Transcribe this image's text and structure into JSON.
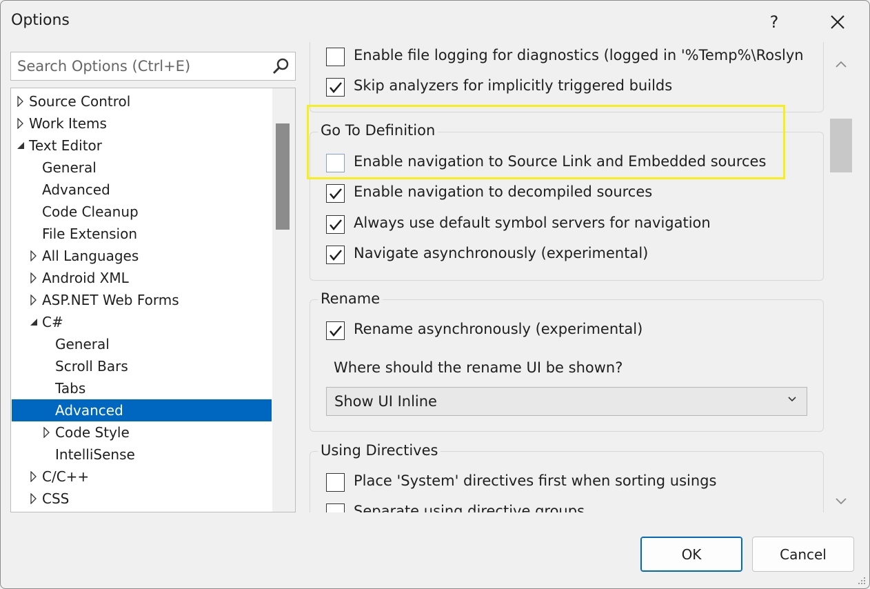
{
  "window": {
    "title": "Options",
    "help_label": "?"
  },
  "search": {
    "placeholder": "Search Options (Ctrl+E)"
  },
  "tree": [
    {
      "label": "Source Control",
      "level": 0,
      "arrow": "collapsed"
    },
    {
      "label": "Work Items",
      "level": 0,
      "arrow": "collapsed"
    },
    {
      "label": "Text Editor",
      "level": 0,
      "arrow": "expanded"
    },
    {
      "label": "General",
      "level": 1,
      "arrow": "none"
    },
    {
      "label": "Advanced",
      "level": 1,
      "arrow": "none"
    },
    {
      "label": "Code Cleanup",
      "level": 1,
      "arrow": "none"
    },
    {
      "label": "File Extension",
      "level": 1,
      "arrow": "none"
    },
    {
      "label": "All Languages",
      "level": 1,
      "arrow": "collapsed"
    },
    {
      "label": "Android XML",
      "level": 1,
      "arrow": "collapsed"
    },
    {
      "label": "ASP.NET Web Forms",
      "level": 1,
      "arrow": "collapsed"
    },
    {
      "label": "C#",
      "level": 1,
      "arrow": "expanded"
    },
    {
      "label": "General",
      "level": 2,
      "arrow": "none"
    },
    {
      "label": "Scroll Bars",
      "level": 2,
      "arrow": "none"
    },
    {
      "label": "Tabs",
      "level": 2,
      "arrow": "none"
    },
    {
      "label": "Advanced",
      "level": 2,
      "arrow": "none",
      "selected": true
    },
    {
      "label": "Code Style",
      "level": 2,
      "arrow": "collapsed"
    },
    {
      "label": "IntelliSense",
      "level": 2,
      "arrow": "none"
    },
    {
      "label": "C/C++",
      "level": 1,
      "arrow": "collapsed"
    },
    {
      "label": "CSS",
      "level": 1,
      "arrow": "collapsed"
    }
  ],
  "top_group": {
    "items": [
      {
        "label": "Enable file logging for diagnostics (logged in '%Temp%\\Roslyn",
        "checked": false
      },
      {
        "label": "Skip analyzers for implicitly triggered builds",
        "checked": true
      }
    ]
  },
  "go_to_definition": {
    "title": "Go To Definition",
    "items": [
      {
        "label": "Enable navigation to Source Link and Embedded sources",
        "checked": false
      },
      {
        "label": "Enable navigation to decompiled sources",
        "checked": true
      },
      {
        "label": "Always use default symbol servers for navigation",
        "checked": true
      },
      {
        "label": "Navigate asynchronously (experimental)",
        "checked": true
      }
    ]
  },
  "rename": {
    "title": "Rename",
    "items": [
      {
        "label": "Rename asynchronously (experimental)",
        "checked": true
      }
    ],
    "question": "Where should the rename UI be shown?",
    "dropdown_value": "Show UI Inline"
  },
  "using_directives": {
    "title": "Using Directives",
    "items": [
      {
        "label": "Place 'System' directives first when sorting usings",
        "checked": false
      },
      {
        "label": "Separate using directive groups",
        "checked": false
      }
    ]
  },
  "buttons": {
    "ok": "OK",
    "cancel": "Cancel"
  },
  "colors": {
    "selection": "#0067c0",
    "highlight": "#f7ef19"
  }
}
